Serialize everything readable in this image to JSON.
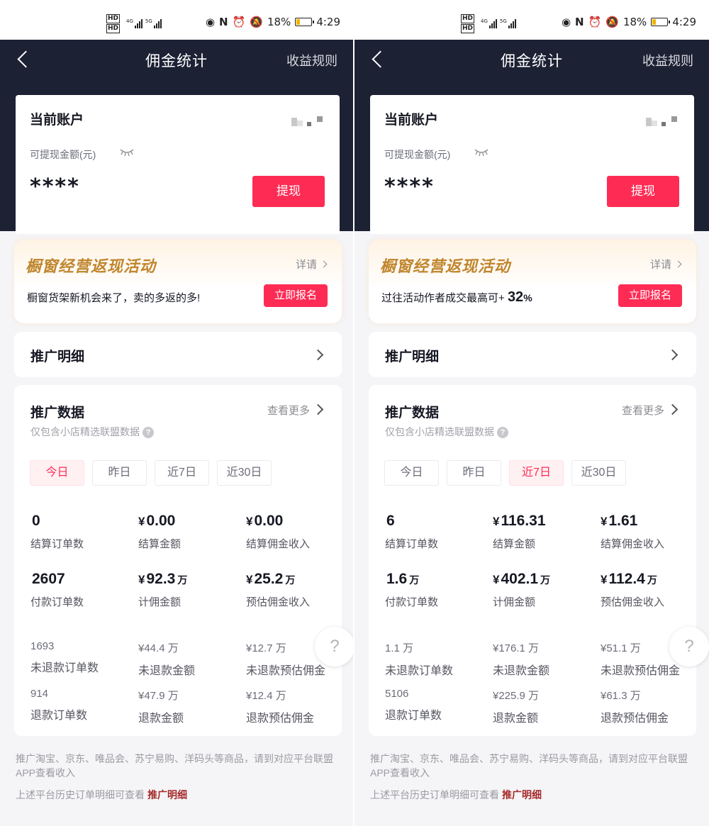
{
  "screens": [
    {
      "status": {
        "hd1": "HD",
        "hd2": "HD",
        "net1": "4G",
        "net2": "5G",
        "battery": "18%",
        "time": "4:29"
      },
      "nav": {
        "title": "佣金统计",
        "rule": "收益规则"
      },
      "account": {
        "title": "当前账户",
        "withdraw_label": "可提现金额(元)",
        "amount": "****",
        "withdraw_button": "提现"
      },
      "banner": {
        "title": "橱窗经营返现活动",
        "detail": "详请",
        "desc_prefix": "橱窗货架新机会来了，卖的多返的多!",
        "desc_number": "",
        "desc_unit": "",
        "signup": "立即报名"
      },
      "promo_detail": "推广明细",
      "data": {
        "title": "推广数据",
        "more": "查看更多",
        "subtitle": "仅包含小店精选联盟数据",
        "help": "?",
        "tabs": [
          "今日",
          "昨日",
          "近7日",
          "近30日"
        ],
        "active_tab": 0,
        "metrics_top": [
          {
            "yen": "",
            "value": "0",
            "unit": "",
            "label": "结算订单数"
          },
          {
            "yen": "¥",
            "value": "0.00",
            "unit": "",
            "label": "结算金额"
          },
          {
            "yen": "¥",
            "value": "0.00",
            "unit": "",
            "label": "结算佣金收入"
          },
          {
            "yen": "",
            "value": "2607",
            "unit": "",
            "label": "付款订单数"
          },
          {
            "yen": "¥",
            "value": "92.3",
            "unit": "万",
            "label": "计佣金额"
          },
          {
            "yen": "¥",
            "value": "25.2",
            "unit": "万",
            "label": "预估佣金收入"
          }
        ],
        "metrics_small": [
          {
            "value": "1693",
            "label": "未退款订单数"
          },
          {
            "value": "¥44.4 万",
            "label": "未退款金额"
          },
          {
            "value": "¥12.7 万",
            "label": "未退款预估佣金"
          },
          {
            "value": "914",
            "label": "退款订单数"
          },
          {
            "value": "¥47.9 万",
            "label": "退款金额"
          },
          {
            "value": "¥12.4 万",
            "label": "退款预估佣金"
          }
        ]
      },
      "float_help": "?",
      "footer": {
        "note": "推广淘宝、京东、唯品会、苏宁易购、洋码头等商品，请到对应平台联盟APP查看收入",
        "history": "上述平台历史订单明细可查看",
        "link": "推广明细"
      }
    },
    {
      "status": {
        "hd1": "HD",
        "hd2": "HD",
        "net1": "4G",
        "net2": "5G",
        "battery": "18%",
        "time": "4:29"
      },
      "nav": {
        "title": "佣金统计",
        "rule": "收益规则"
      },
      "account": {
        "title": "当前账户",
        "withdraw_label": "可提现金额(元)",
        "amount": "****",
        "withdraw_button": "提现"
      },
      "banner": {
        "title": "橱窗经营返现活动",
        "detail": "详请",
        "desc_prefix": "过往活动作者成交最高可+",
        "desc_number": "32",
        "desc_unit": "%",
        "signup": "立即报名"
      },
      "promo_detail": "推广明细",
      "data": {
        "title": "推广数据",
        "more": "查看更多",
        "subtitle": "仅包含小店精选联盟数据",
        "help": "?",
        "tabs": [
          "今日",
          "昨日",
          "近7日",
          "近30日"
        ],
        "active_tab": 2,
        "metrics_top": [
          {
            "yen": "",
            "value": "6",
            "unit": "",
            "label": "结算订单数"
          },
          {
            "yen": "¥",
            "value": "116.31",
            "unit": "",
            "label": "结算金额"
          },
          {
            "yen": "¥",
            "value": "1.61",
            "unit": "",
            "label": "结算佣金收入"
          },
          {
            "yen": "",
            "value": "1.6",
            "unit": "万",
            "label": "付款订单数"
          },
          {
            "yen": "¥",
            "value": "402.1",
            "unit": "万",
            "label": "计佣金额"
          },
          {
            "yen": "¥",
            "value": "112.4",
            "unit": "万",
            "label": "预估佣金收入"
          }
        ],
        "metrics_small": [
          {
            "value": "1.1 万",
            "label": "未退款订单数"
          },
          {
            "value": "¥176.1 万",
            "label": "未退款金额"
          },
          {
            "value": "¥51.1 万",
            "label": "未退款预估佣金"
          },
          {
            "value": "5106",
            "label": "退款订单数"
          },
          {
            "value": "¥225.9 万",
            "label": "退款金额"
          },
          {
            "value": "¥61.3 万",
            "label": "退款预估佣金"
          }
        ]
      },
      "float_help": "?",
      "footer": {
        "note": "推广淘宝、京东、唯品会、苏宁易购、洋码头等商品，请到对应平台联盟APP查看收入",
        "history": "上述平台历史订单明细可查看",
        "link": "推广明细"
      }
    }
  ]
}
